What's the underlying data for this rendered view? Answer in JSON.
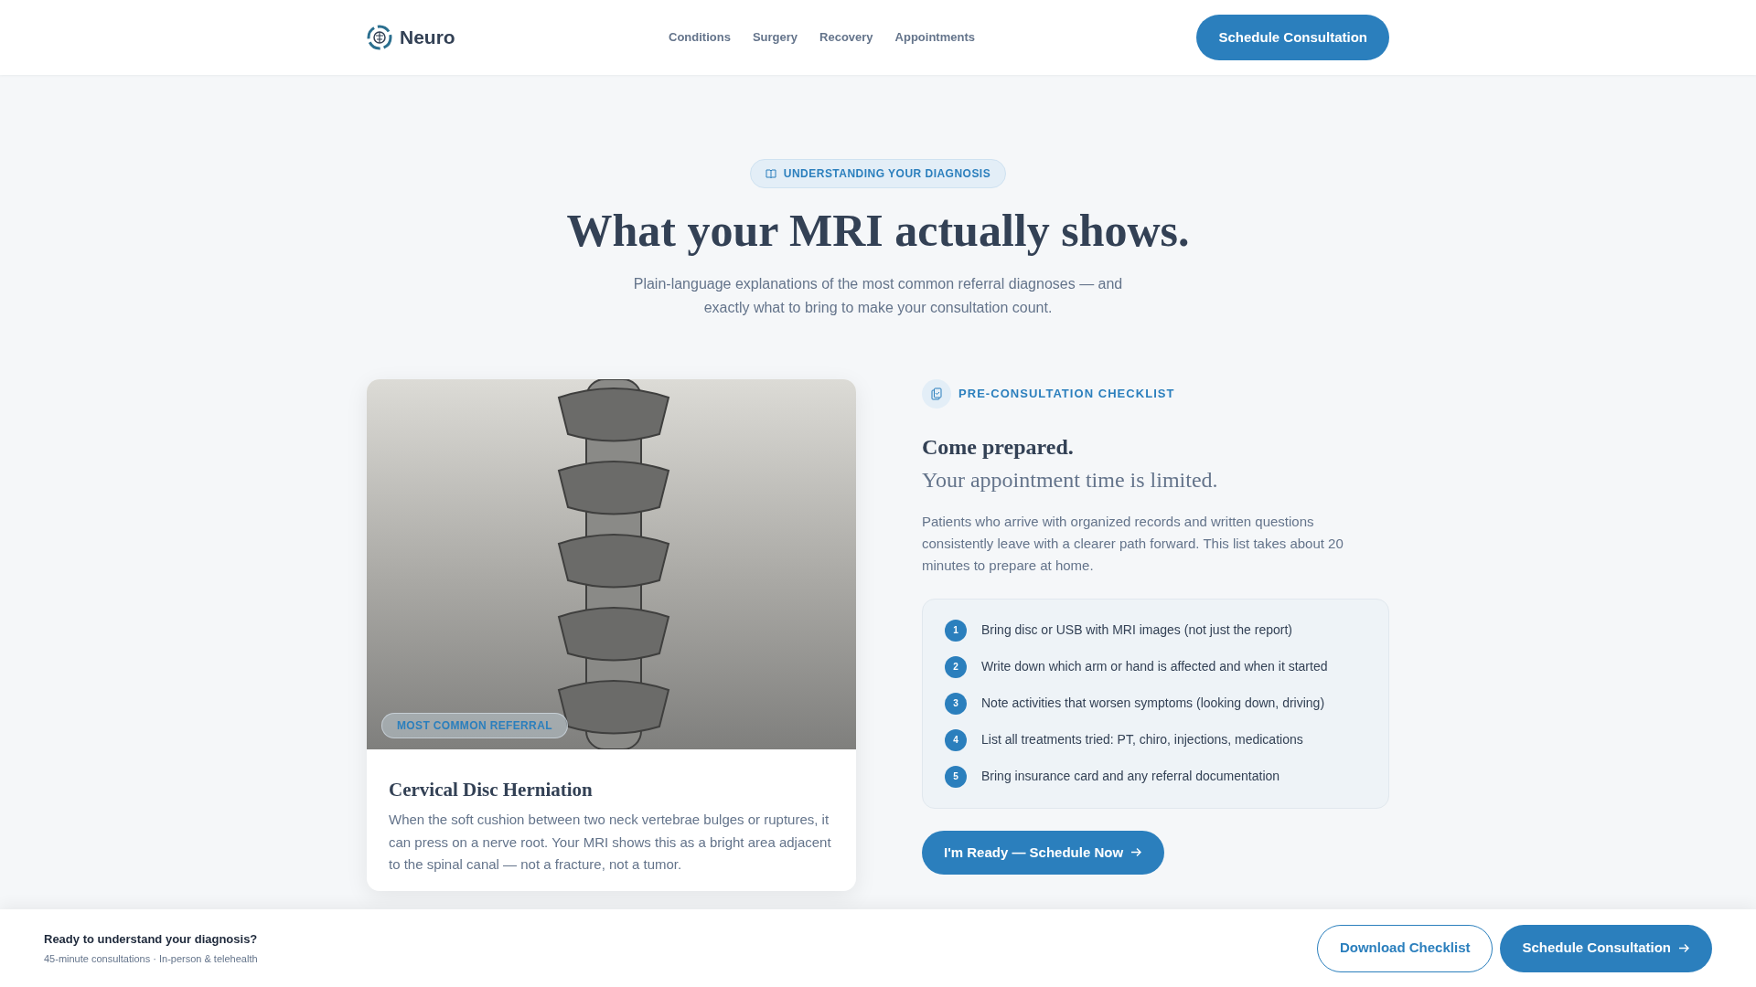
{
  "header": {
    "logo": "Neuro",
    "nav": [
      {
        "label": "Conditions"
      },
      {
        "label": "Surgery"
      },
      {
        "label": "Recovery"
      },
      {
        "label": "Appointments"
      }
    ],
    "cta": "Schedule Consultation"
  },
  "hero": {
    "eyebrow": "UNDERSTANDING YOUR DIAGNOSIS",
    "title": "What your MRI actually shows.",
    "subtitle": "Plain-language explanations of the most common referral diagnoses — and exactly what to bring to make your consultation count."
  },
  "condition_card": {
    "badge": "MOST COMMON REFERRAL",
    "title": "Cervical Disc Herniation",
    "description": "When the soft cushion between two neck vertebrae bulges or ruptures, it can press on a nerve root. Your MRI shows this as a bright area adjacent to the spinal canal — not a fracture, not a tumor."
  },
  "checklist": {
    "eyebrow": "PRE-CONSULTATION CHECKLIST",
    "title": "Come prepared.",
    "subtitle": "Your appointment time is limited.",
    "intro": "Patients who arrive with organized records and written questions consistently leave with a clearer path forward. This list takes about 20 minutes to prepare at home.",
    "items": [
      {
        "number": "1",
        "text": "Bring disc or USB with MRI images (not just the report)"
      },
      {
        "number": "2",
        "text": "Write down which arm or hand is affected and when it started"
      },
      {
        "number": "3",
        "text": "Note activities that worsen symptoms (looking down, driving)"
      },
      {
        "number": "4",
        "text": "List all treatments tried: PT, chiro, injections, medications"
      },
      {
        "number": "5",
        "text": "Bring insurance card and any referral documentation"
      }
    ],
    "button": "I'm Ready — Schedule Now"
  },
  "bottom_bar": {
    "title": "Ready to understand your diagnosis?",
    "subtitle": "45-minute consultations · In-person & telehealth",
    "buttons": [
      {
        "label": "Download Checklist",
        "kind": "outline"
      },
      {
        "label": "Schedule Consultation",
        "kind": "primary"
      }
    ]
  }
}
